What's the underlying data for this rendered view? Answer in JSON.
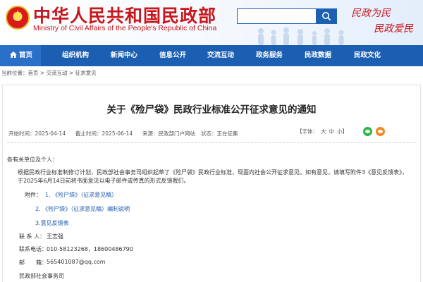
{
  "header": {
    "title": "中华人民共和国民政部",
    "subtitle": "Ministry of Civil Affairs of the People's Republic of China",
    "search_placeholder": "",
    "slogan_1": "民政为民",
    "slogan_2": "民政爱民"
  },
  "nav": {
    "items": [
      {
        "label": "首页",
        "icon": "home-icon"
      },
      {
        "label": "组织机构"
      },
      {
        "label": "新闻中心"
      },
      {
        "label": "信息公开"
      },
      {
        "label": "交流互动"
      },
      {
        "label": "政务服务"
      },
      {
        "label": "民政数据"
      },
      {
        "label": "民政文化"
      }
    ]
  },
  "breadcrumb": {
    "prefix": "当前位置：",
    "items": [
      "首页",
      "交流互动",
      "征求意见"
    ],
    "separator": " > "
  },
  "article": {
    "title": "关于《殓尸袋》民政行业标准公开征求意见的通知",
    "start_date": "开始时间：2025-04-14",
    "end_date": "截止时间：2025-06-14",
    "source": "来源：民政部门户网站",
    "status": "状态：正在征集",
    "font_label": "【字体：",
    "font_large": "大",
    "font_medium": "中",
    "font_small": "小】",
    "greeting": "各有关单位及个人：",
    "paragraph": "根据民政行业标准制修订计划，民政部社会事务司组织起草了《殓尸袋》民政行业标准，现面向社会公开征求意见。如有意见，请填写附件3《意见反馈表》，于2025年6月14日前将书面意见以电子邮件或传真的形式反馈我们。",
    "attachments_label": "附件：",
    "attachments": [
      "1. 《殓尸袋》（征求意见稿）",
      "2. 《殓尸袋》（征求意见稿）编制说明",
      "3.意见反馈表"
    ],
    "contact_label": "联 系 人：",
    "contact_name": "王志强",
    "phone_label": "联系电话：",
    "phone_value": "010-58123268，18600486790",
    "email_label": "邮　　箱：",
    "email_value": "565401087@qq.com",
    "signature": "民政部社会事务司"
  },
  "colors": {
    "brand_red": "#c8161d",
    "nav_blue": "#1c5eb1",
    "link_blue": "#1a59b0"
  }
}
